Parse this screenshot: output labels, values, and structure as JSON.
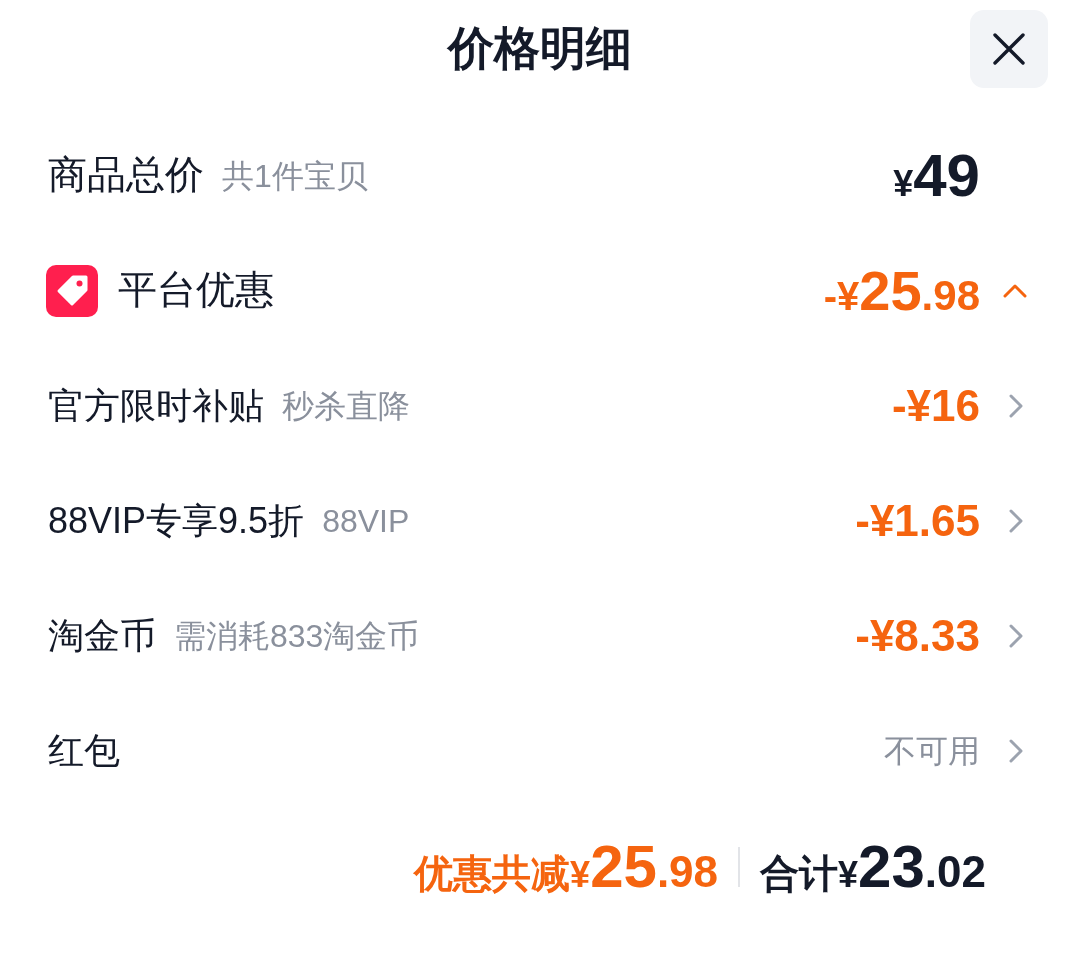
{
  "header": {
    "title": "价格明细"
  },
  "subtotal": {
    "label": "商品总价",
    "note": "共1件宝贝",
    "price": {
      "prefix": "¥",
      "integer": "49"
    }
  },
  "platform_discount": {
    "label": "平台优惠",
    "expanded": true,
    "amount": {
      "prefix": "-¥",
      "integer": "25",
      "fraction": ".98"
    },
    "items": [
      {
        "label": "官方限时补贴",
        "note": "秒杀直降",
        "value": "-¥16",
        "available": true
      },
      {
        "label": "88VIP专享9.5折",
        "note": "88VIP",
        "value": "-¥1.65",
        "available": true
      },
      {
        "label": "淘金币",
        "note": "需消耗833淘金币",
        "value": "-¥8.33",
        "available": true
      },
      {
        "label": "红包",
        "value": "不可用",
        "available": false
      }
    ]
  },
  "summary": {
    "discount": {
      "label": "优惠共减",
      "prefix": "¥",
      "integer": "25",
      "fraction": ".98"
    },
    "total": {
      "label": "合计",
      "prefix": "¥",
      "integer": "23",
      "fraction": ".02"
    }
  }
}
